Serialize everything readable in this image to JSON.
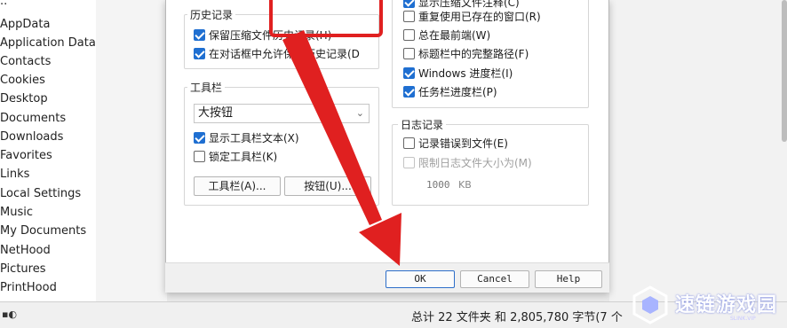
{
  "folders": [
    "..",
    "AppData",
    "Application Data",
    "Contacts",
    "Cookies",
    "Desktop",
    "Documents",
    "Downloads",
    "Favorites",
    "Links",
    "Local Settings",
    "Music",
    "My Documents",
    "NetHood",
    "Pictures",
    "PrintHood"
  ],
  "status_bar": {
    "summary": "总计 22 文件夹 和 2,805,780 字节(7 个"
  },
  "history": {
    "title": "历史记录",
    "items": [
      {
        "label": "保留压缩文件历史记录(H)",
        "checked": true
      },
      {
        "label": "在对话框中允许保存历史记录(D",
        "checked": true
      }
    ]
  },
  "toolbar_group": {
    "title": "工具栏",
    "size_select": "大按钮",
    "items": [
      {
        "label": "显示工具栏文本(X)",
        "checked": true
      },
      {
        "label": "锁定工具栏(K)",
        "checked": false
      }
    ],
    "toolbar_button": "工具栏(A)...",
    "buttons_button": "按钮(U)..."
  },
  "display_options": [
    {
      "label": "显示压缩文件注释(C)",
      "checked": true
    },
    {
      "label": "重复使用已存在的窗口(R)",
      "checked": false
    },
    {
      "label": "总在最前端(W)",
      "checked": false
    },
    {
      "label": "标题栏中的完整路径(F)",
      "checked": false
    },
    {
      "label": "Windows 进度栏(I)",
      "checked": true
    },
    {
      "label": "任务栏进度栏(P)",
      "checked": true
    }
  ],
  "log": {
    "title": "日志记录",
    "items": [
      {
        "label": "记录错误到文件(E)",
        "checked": false
      },
      {
        "label": "限制日志文件大小为(M)",
        "checked": false,
        "disabled": true
      }
    ],
    "size_value": "1000",
    "size_unit": "KB"
  },
  "footer": {
    "ok": "OK",
    "cancel": "Cancel",
    "help": "Help"
  },
  "watermark": {
    "text": "速链游戏园",
    "sub": "SLINK.VIP"
  },
  "colors": {
    "accent": "#1f6fd1",
    "annotation": "#e02020"
  }
}
